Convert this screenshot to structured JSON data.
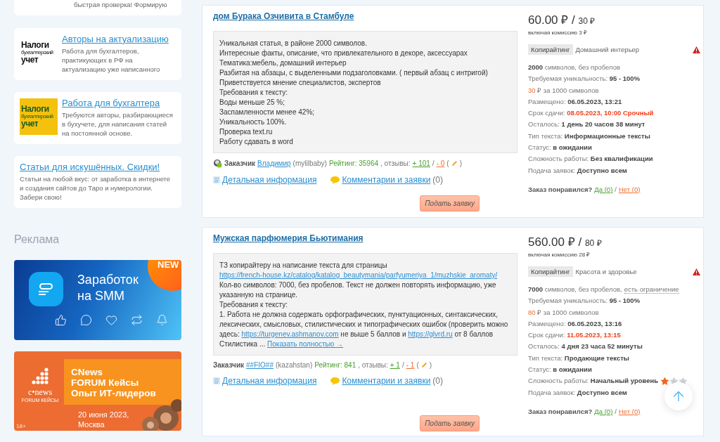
{
  "sidebar": {
    "top_card_text": "быстрая проверка! Формирую",
    "promos": [
      {
        "title": "Авторы на актуализацию",
        "text": "Работа для бухгалтеров, практикующих в РФ на актуализацию уже написанного",
        "logo": {
          "kind": "white",
          "lines": [
            "Налоги",
            "бухгалтерский",
            "учет"
          ]
        }
      },
      {
        "title": "Работа для бухгалтера",
        "text": "Требуются авторы, разбирающиеся в бухучете, для написания статей на постоянной основе.",
        "logo": {
          "kind": "yellow",
          "lines": [
            "Налоги",
            "бухгалтерский",
            "учет"
          ]
        }
      },
      {
        "title": "Статьи для искушённых. Скидки!",
        "text": "Статьи на любой вкус: от заработка в интернете и создания сайтов до Таро и нумерологии. Забери свою!"
      }
    ],
    "ads_heading": "Реклама",
    "ads": [
      {
        "kind": "smm",
        "title": [
          "Заработок",
          "на SMM"
        ],
        "badge": "NEW"
      },
      {
        "kind": "forum",
        "logo": "c•news",
        "logo_sub": "FORUM КЕЙСЫ",
        "title": [
          "CNews",
          "FORUM Кейсы",
          "Опыт ИТ-лидеров"
        ],
        "date": [
          "20 июня 2023,",
          "Москва"
        ],
        "age": "18+"
      }
    ]
  },
  "orders": [
    {
      "title": "дом Бурака Озчивита в Стамбуле",
      "description": [
        [
          {
            "text": "Уникальная статья, в районе 2000 символов.",
            "kind": "text"
          }
        ],
        [
          {
            "text": "Интересные факты, описание, что привлекательного в декоре, аксессуарах",
            "kind": "text"
          }
        ],
        [
          {
            "text": "Тематика:мебель, домашний интерьер",
            "kind": "text"
          }
        ],
        [
          {
            "text": "Разбитая на абзацы, с выделенными подзаголовками. ( первый абзац с интригой)",
            "kind": "text"
          }
        ],
        [
          {
            "text": "Приветствуется мнение специалистов, экспертов",
            "kind": "text"
          }
        ],
        [
          {
            "text": "Требования к тексту:",
            "kind": "text"
          }
        ],
        [
          {
            "text": "Воды меньше 25 %;",
            "kind": "text"
          }
        ],
        [
          {
            "text": "Заспамленности менее 42%;",
            "kind": "text"
          }
        ],
        [
          {
            "text": "Уникальность 100%.",
            "kind": "text"
          }
        ],
        [
          {
            "text": "Проверка text.ru",
            "kind": "text"
          }
        ],
        [
          {
            "text": "Работу сдавать в word",
            "kind": "text"
          }
        ]
      ],
      "customer": {
        "avatar": true,
        "label": "Заказчик",
        "name": "Владимир",
        "login": "(mylilbaby)",
        "rating": "Рейтинг: 35964",
        "reviews": ", отзывы:",
        "plus": "+ 101",
        "separator": "/",
        "minus": "- 0",
        "paren_open": "(",
        "paren_close": ")"
      },
      "details_link": "Детальная информация",
      "comments_link": "Комментарии и заявки",
      "comments_count": "(0)",
      "apply": "Подать заявку",
      "price": "60.00 ₽ /",
      "per_unit": "30 ₽",
      "commission": "включая комиссию 3 ₽",
      "tag": "Копирайтинг",
      "topic": "Домашний интерьер",
      "warning": true,
      "rows": [
        {
          "kind": "chars",
          "count": "2000",
          "text": "символов, без пробелов"
        },
        {
          "kind": "field",
          "label": "Требуемая уникальность:",
          "value": "95 - 100%",
          "urgent": false
        },
        {
          "kind": "rate",
          "accent": "30",
          "text": "₽ за 1000 символов"
        },
        {
          "kind": "field",
          "label": "Размещено:",
          "value": "06.05.2023, 13:21",
          "urgent": false
        },
        {
          "kind": "field",
          "label": "Срок сдачи:",
          "value": "08.05.2023, 10:00 Срочный",
          "urgent": true
        },
        {
          "kind": "field",
          "label": "Осталось:",
          "value": "1 день 20 часов 38 минут",
          "urgent": false
        },
        {
          "kind": "field",
          "label": "Тип текста:",
          "value": "Информационные тексты",
          "urgent": false
        },
        {
          "kind": "field",
          "label": "Статус:",
          "value": "в ожидании",
          "urgent": false
        },
        {
          "kind": "field",
          "label": "Сложность работы:",
          "value": "Без квалификации",
          "urgent": false
        },
        {
          "kind": "field",
          "label": "Подача заявок:",
          "value": "Доступно всем",
          "urgent": false
        }
      ],
      "liked": "Заказ понравился?",
      "yes": "Да (0)",
      "like_separator": "/",
      "no": "Нет (0)"
    },
    {
      "title": "Мужская парфюмерия Бьютимания",
      "description": [
        [
          {
            "text": "ТЗ копирайтеру на написание текста для страницы ",
            "kind": "text"
          },
          {
            "text": "https://french-house.kz/catalog/katalog_beautymania/parfyumeriya_1/muzhskie_aromaty/",
            "kind": "link"
          }
        ],
        [
          {
            "text": "Кол-во символов: 7000, без пробелов. Текст не должен повторять информацию, уже указанную на странице.",
            "kind": "text"
          }
        ],
        [
          {
            "text": "Требования к тексту:",
            "kind": "text"
          }
        ],
        [
          {
            "text": "1. Работа не должна содержать орфографических, пунктуационных, синтаксических, лексических, смысловых, стилистических и типографических ошибок (проверить можно здесь: ",
            "kind": "text"
          },
          {
            "text": "https://turgenev.ashmanov.com",
            "kind": "link"
          },
          {
            "text": " не выше 5 баллов и ",
            "kind": "text"
          },
          {
            "text": "https://glvrd.ru",
            "kind": "link"
          },
          {
            "text": " от 8 баллов Стилистика ... ",
            "kind": "text"
          },
          {
            "text": "Показать полностью →",
            "kind": "link"
          }
        ]
      ],
      "customer": {
        "label": "Заказчик",
        "name": "##FIO##",
        "login": "(kazahstan)",
        "rating": "Рейтинг: 841",
        "reviews": ", отзывы:",
        "plus": "+ 1",
        "separator": "/",
        "minus": "- 1",
        "paren_open": "(",
        "paren_close": ")"
      },
      "details_link": "Детальная информация",
      "comments_link": "Комментарии и заявки",
      "comments_count": "(0)",
      "apply": "Подать заявку",
      "price": "560.00 ₽ /",
      "per_unit": "80 ₽",
      "commission": "включая комиссию 28 ₽",
      "tag": "Копирайтинг",
      "topic": "Красота и здоровье",
      "warning": true,
      "rows": [
        {
          "kind": "chars",
          "count": "7000",
          "text": "символов, без пробелов,",
          "limit": "есть ограничение"
        },
        {
          "kind": "field",
          "label": "Требуемая уникальность:",
          "value": "95 - 100%",
          "urgent": false
        },
        {
          "kind": "rate",
          "accent": "80",
          "text": "₽ за 1000 символов"
        },
        {
          "kind": "field",
          "label": "Размещено:",
          "value": "06.05.2023, 13:16",
          "urgent": false
        },
        {
          "kind": "field",
          "label": "Срок сдачи:",
          "value": "11.05.2023, 13:15",
          "urgent": true
        },
        {
          "kind": "field",
          "label": "Осталось:",
          "value": "4 дня 23 часа 52 минуты",
          "urgent": false
        },
        {
          "kind": "field",
          "label": "Тип текста:",
          "value": "Продающие тексты",
          "urgent": false
        },
        {
          "kind": "field",
          "label": "Статус:",
          "value": "в ожидании",
          "urgent": false
        },
        {
          "kind": "field",
          "label": "Сложность работы:",
          "value": "Начальный уровень",
          "urgent": false,
          "stars": 1
        },
        {
          "kind": "field",
          "label": "Подача заявок:",
          "value": "Доступно всем",
          "urgent": false
        }
      ],
      "liked": "Заказ понравился?",
      "yes": "Да (0)",
      "like_separator": "/",
      "no": "Нет (0)"
    }
  ]
}
